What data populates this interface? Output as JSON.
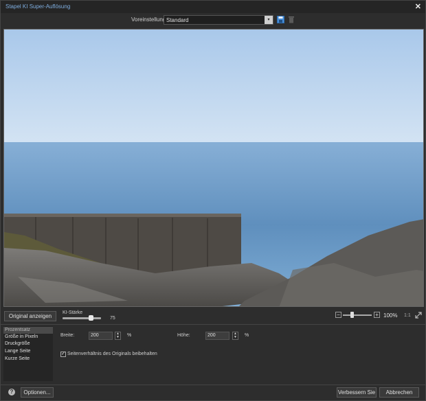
{
  "window": {
    "title": "Stapel KI Super-Auflösung",
    "close_glyph": "✕"
  },
  "preset": {
    "label": "Voreinstellung",
    "value": "Standard",
    "arrow": "▾",
    "save_icon": "save-icon",
    "delete_icon": "trash-icon"
  },
  "controls": {
    "show_original_label": "Original anzeigen",
    "strength_label": "KI-Stärke",
    "strength_value": "75",
    "strength_level_percent": 75,
    "zoom_minus": "−",
    "zoom_plus": "+",
    "zoom_value": "100%",
    "zoom_ratio": "1:1"
  },
  "sidebar": {
    "items": [
      {
        "label": "Prozentsatz",
        "active": true
      },
      {
        "label": "Größe in Pixeln",
        "active": false
      },
      {
        "label": "Druckgröße",
        "active": false
      },
      {
        "label": "Lange Seite",
        "active": false
      },
      {
        "label": "Kurze Seite",
        "active": false
      }
    ]
  },
  "resize": {
    "width_label": "Breite:",
    "width_value": "200",
    "width_unit": "%",
    "height_label": "Höhe:",
    "height_value": "200",
    "height_unit": "%",
    "keep_aspect_label": "Seitenverhältnis des Originals beibehalten",
    "keep_aspect_checked": true,
    "check_glyph": "✓"
  },
  "footer": {
    "help_glyph": "?",
    "options_label": "Optionen...",
    "enhance_label": "Verbessern Sie",
    "cancel_label": "Abbrechen"
  },
  "colors": {
    "title_accent": "#7faee0",
    "background": "#2d2d2d",
    "sky": "#b9d3ef",
    "sea": "#6f9cc6"
  }
}
